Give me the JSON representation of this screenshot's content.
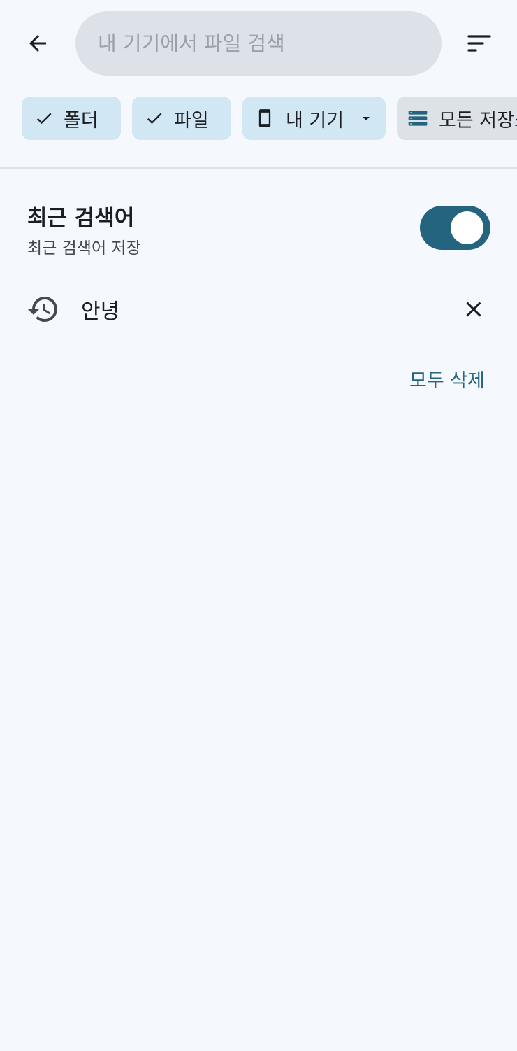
{
  "search": {
    "placeholder": "내 기기에서 파일 검색"
  },
  "chips": {
    "folder": "폴더",
    "file": "파일",
    "device": "내 기기",
    "storage": "모든 저장소"
  },
  "recent": {
    "title": "최근 검색어",
    "subtitle": "최근 검색어 저장",
    "toggle_on": true,
    "items": [
      {
        "text": "안녕"
      }
    ],
    "clear_all": "모두 삭제"
  },
  "colors": {
    "accent": "#24647f",
    "chip_selected": "#d1e7f3",
    "chip_unselected": "#dde2e8",
    "background": "#f5f9fd"
  }
}
